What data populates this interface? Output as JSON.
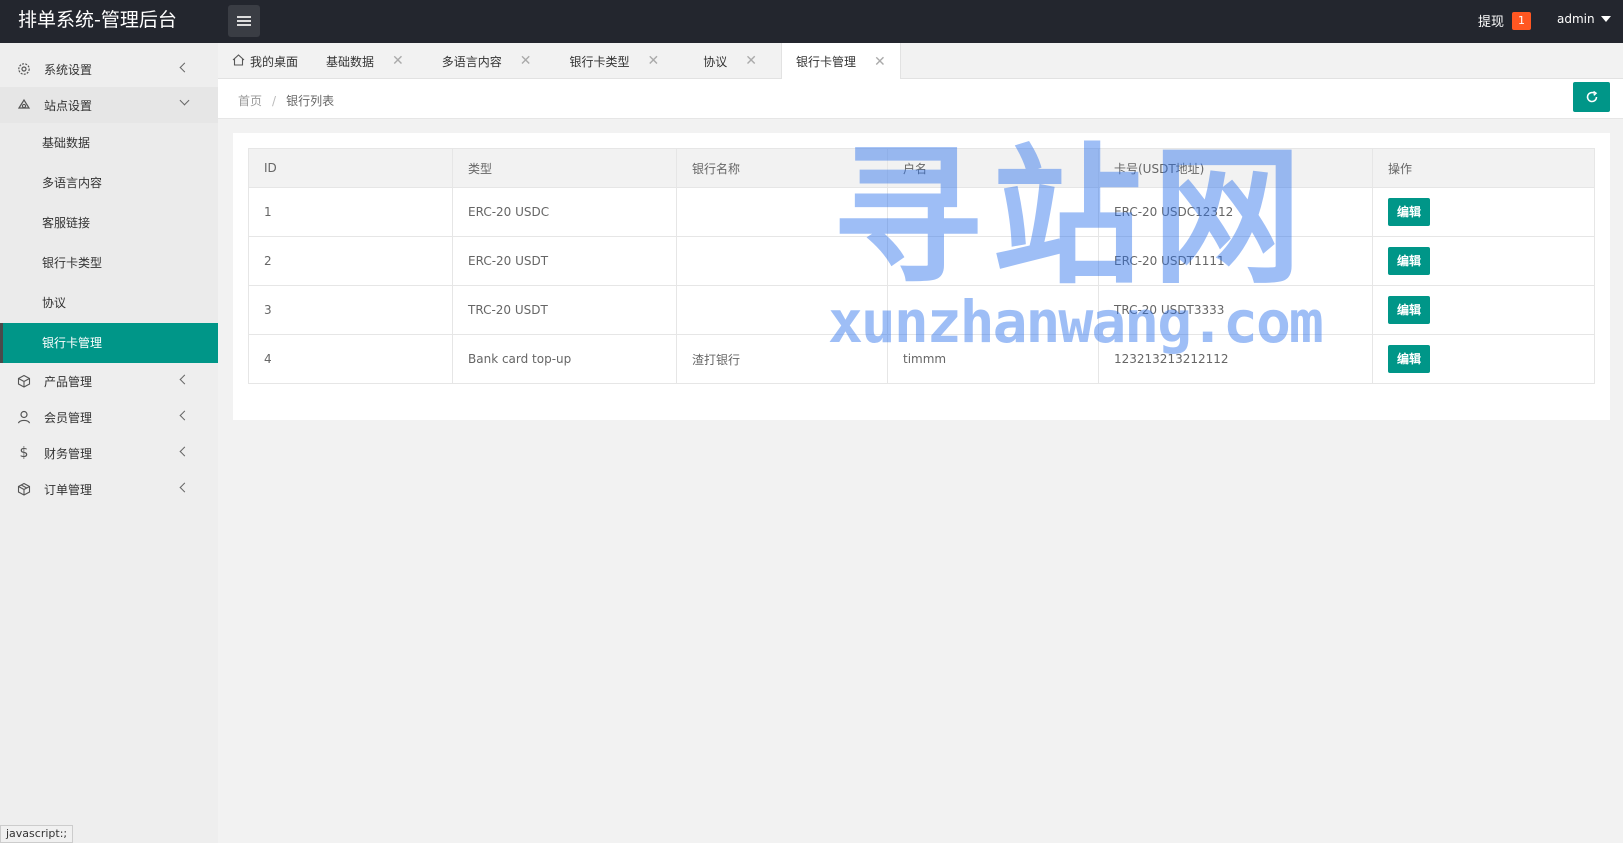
{
  "header": {
    "title": "排单系统-管理后台",
    "withdraw_label": "提现",
    "withdraw_badge": "1",
    "user_name": "admin"
  },
  "sidebar": {
    "groups": [
      {
        "label": "系统设置",
        "icon": "gear-icon"
      },
      {
        "label": "站点设置",
        "icon": "site-icon"
      },
      {
        "label": "产品管理",
        "icon": "box-icon"
      },
      {
        "label": "会员管理",
        "icon": "user-icon"
      },
      {
        "label": "财务管理",
        "icon": "dollar-icon"
      },
      {
        "label": "订单管理",
        "icon": "package-icon"
      }
    ],
    "site_items": [
      "基础数据",
      "多语言内容",
      "客服链接",
      "银行卡类型",
      "协议",
      "银行卡管理"
    ]
  },
  "tabs": [
    {
      "label": "我的桌面"
    },
    {
      "label": "基础数据"
    },
    {
      "label": "多语言内容"
    },
    {
      "label": "银行卡类型"
    },
    {
      "label": "协议"
    },
    {
      "label": "银行卡管理"
    }
  ],
  "breadcrumb": {
    "home": "首页",
    "sep": "/",
    "current": "银行列表"
  },
  "table": {
    "headers": [
      "ID",
      "类型",
      "银行名称",
      "户名",
      "卡号(USDT地址)",
      "操作"
    ],
    "rows": [
      {
        "id": "1",
        "type": "ERC-20 USDC",
        "bank": "",
        "holder": "",
        "card": "ERC-20 USDC12312",
        "action": "编辑"
      },
      {
        "id": "2",
        "type": "ERC-20 USDT",
        "bank": "",
        "holder": "",
        "card": "ERC-20 USDT1111",
        "action": "编辑"
      },
      {
        "id": "3",
        "type": "TRC-20 USDT",
        "bank": "",
        "holder": "",
        "card": "TRC-20 USDT3333",
        "action": "编辑"
      },
      {
        "id": "4",
        "type": "Bank card top-up",
        "bank": "渣打银行",
        "holder": "timmm",
        "card": "123213213212112",
        "action": "编辑"
      }
    ]
  },
  "watermark": {
    "cn": "寻站网",
    "en": "xunzhanwang.com"
  },
  "statusbar": "javascript:;",
  "colors": {
    "accent": "#009688",
    "header_bg": "#23262e",
    "badge": "#ff5722"
  }
}
